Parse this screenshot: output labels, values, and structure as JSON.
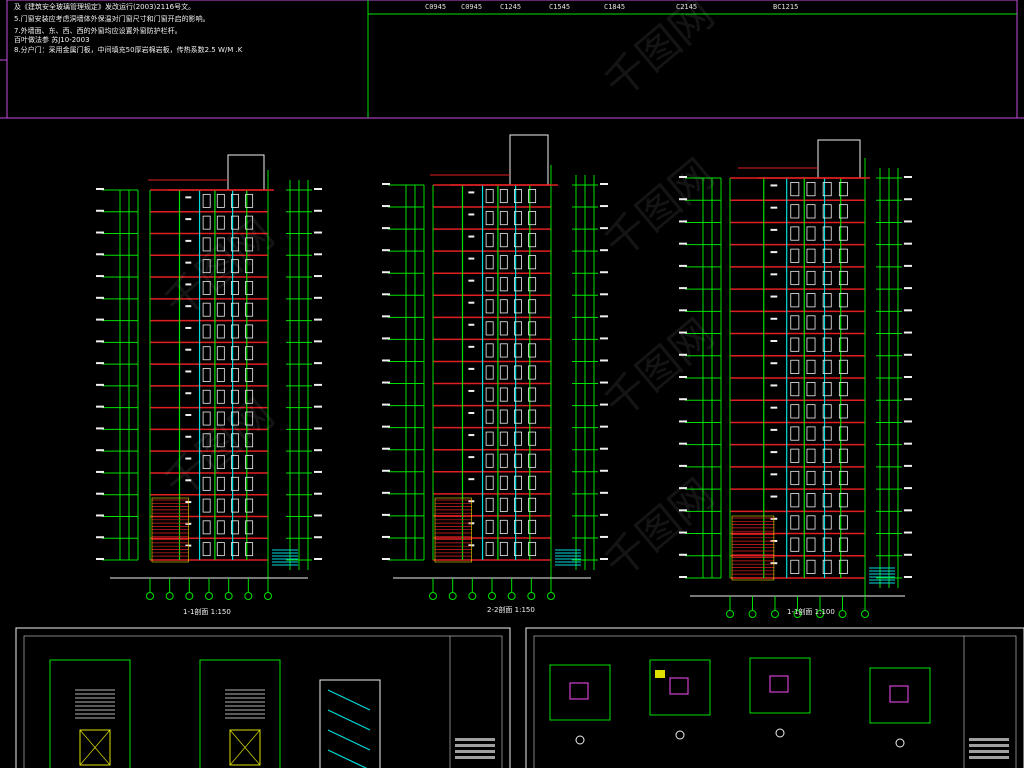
{
  "notes": {
    "lines": [
      "及《建筑安全玻璃管理规定》发改运行(2003)2116号文。",
      "5.门窗安装应考虑洞墙体外保温对门窗尺寸和门窗开启的影响。",
      "7.外墙面、东、西、西的外窗均应设置外窗防护栏杆。",
      "  百叶做法参  苏J10-2003",
      "8.分户门：采用金属门板，中间填充50厚岩棉岩板，传热系数2.5 W/M .K"
    ]
  },
  "window_codes": [
    "C0945",
    "C0945",
    "C1245",
    "C1545",
    "C1845",
    "C2145",
    "BC1215"
  ],
  "sections": [
    {
      "label": "1-1剖面 1:150"
    },
    {
      "label": "2-2剖面 1:150"
    },
    {
      "label": "1-1剖面 1:100"
    }
  ],
  "colors": {
    "background": "#000000",
    "frame": "#c34ce0",
    "cad_green": "#00e000",
    "cad_cyan": "#00dcdc",
    "cad_red": "#e02020",
    "cad_white": "#f0f0f0",
    "cad_magenta": "#d040d0",
    "cad_yellow": "#e0e000",
    "cad_gray": "#a0a0a0",
    "watermark": "#ffffff"
  },
  "watermark": {
    "text": "千图网"
  }
}
